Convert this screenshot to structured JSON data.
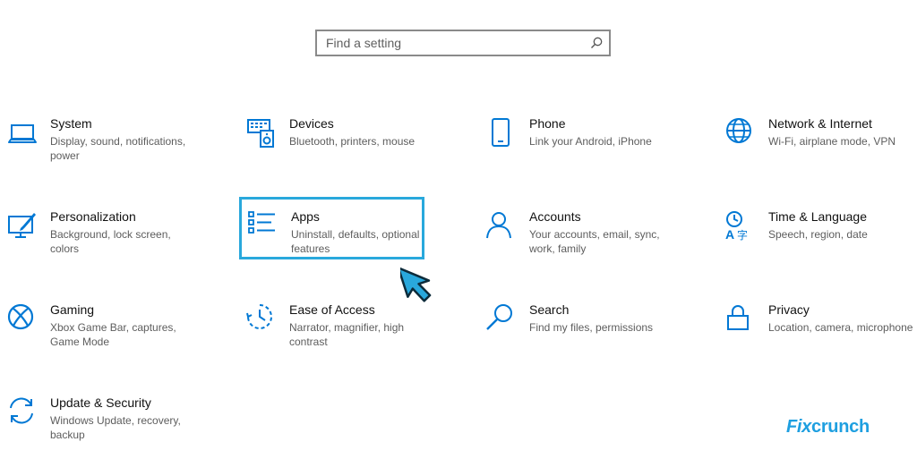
{
  "search": {
    "placeholder": "Find a setting",
    "icon": "search-icon"
  },
  "accent": "#0078d4",
  "highlight_color": "#29a8dc",
  "categories": [
    {
      "title": "System",
      "desc": "Display, sound, notifications, power",
      "icon": "laptop-icon"
    },
    {
      "title": "Devices",
      "desc": "Bluetooth, printers, mouse",
      "icon": "keyboard-speaker-icon"
    },
    {
      "title": "Phone",
      "desc": "Link your Android, iPhone",
      "icon": "phone-icon"
    },
    {
      "title": "Network & Internet",
      "desc": "Wi-Fi, airplane mode, VPN",
      "icon": "globe-icon"
    },
    {
      "title": "Personalization",
      "desc": "Background, lock screen, colors",
      "icon": "paint-brush-icon"
    },
    {
      "title": "Apps",
      "desc": "Uninstall, defaults, optional features",
      "icon": "apps-list-icon"
    },
    {
      "title": "Accounts",
      "desc": "Your accounts, email, sync, work, family",
      "icon": "person-icon"
    },
    {
      "title": "Time & Language",
      "desc": "Speech, region, date",
      "icon": "time-language-icon"
    },
    {
      "title": "Gaming",
      "desc": "Xbox Game Bar, captures, Game Mode",
      "icon": "xbox-icon"
    },
    {
      "title": "Ease of Access",
      "desc": "Narrator, magnifier, high contrast",
      "icon": "ease-of-access-icon"
    },
    {
      "title": "Search",
      "desc": "Find my files, permissions",
      "icon": "magnifier-icon"
    },
    {
      "title": "Privacy",
      "desc": "Location, camera, microphone",
      "icon": "lock-icon"
    },
    {
      "title": "Update & Security",
      "desc": "Windows Update, recovery, backup",
      "icon": "sync-icon"
    }
  ],
  "watermark": {
    "part1": "Fix",
    "part2": "crunch"
  }
}
